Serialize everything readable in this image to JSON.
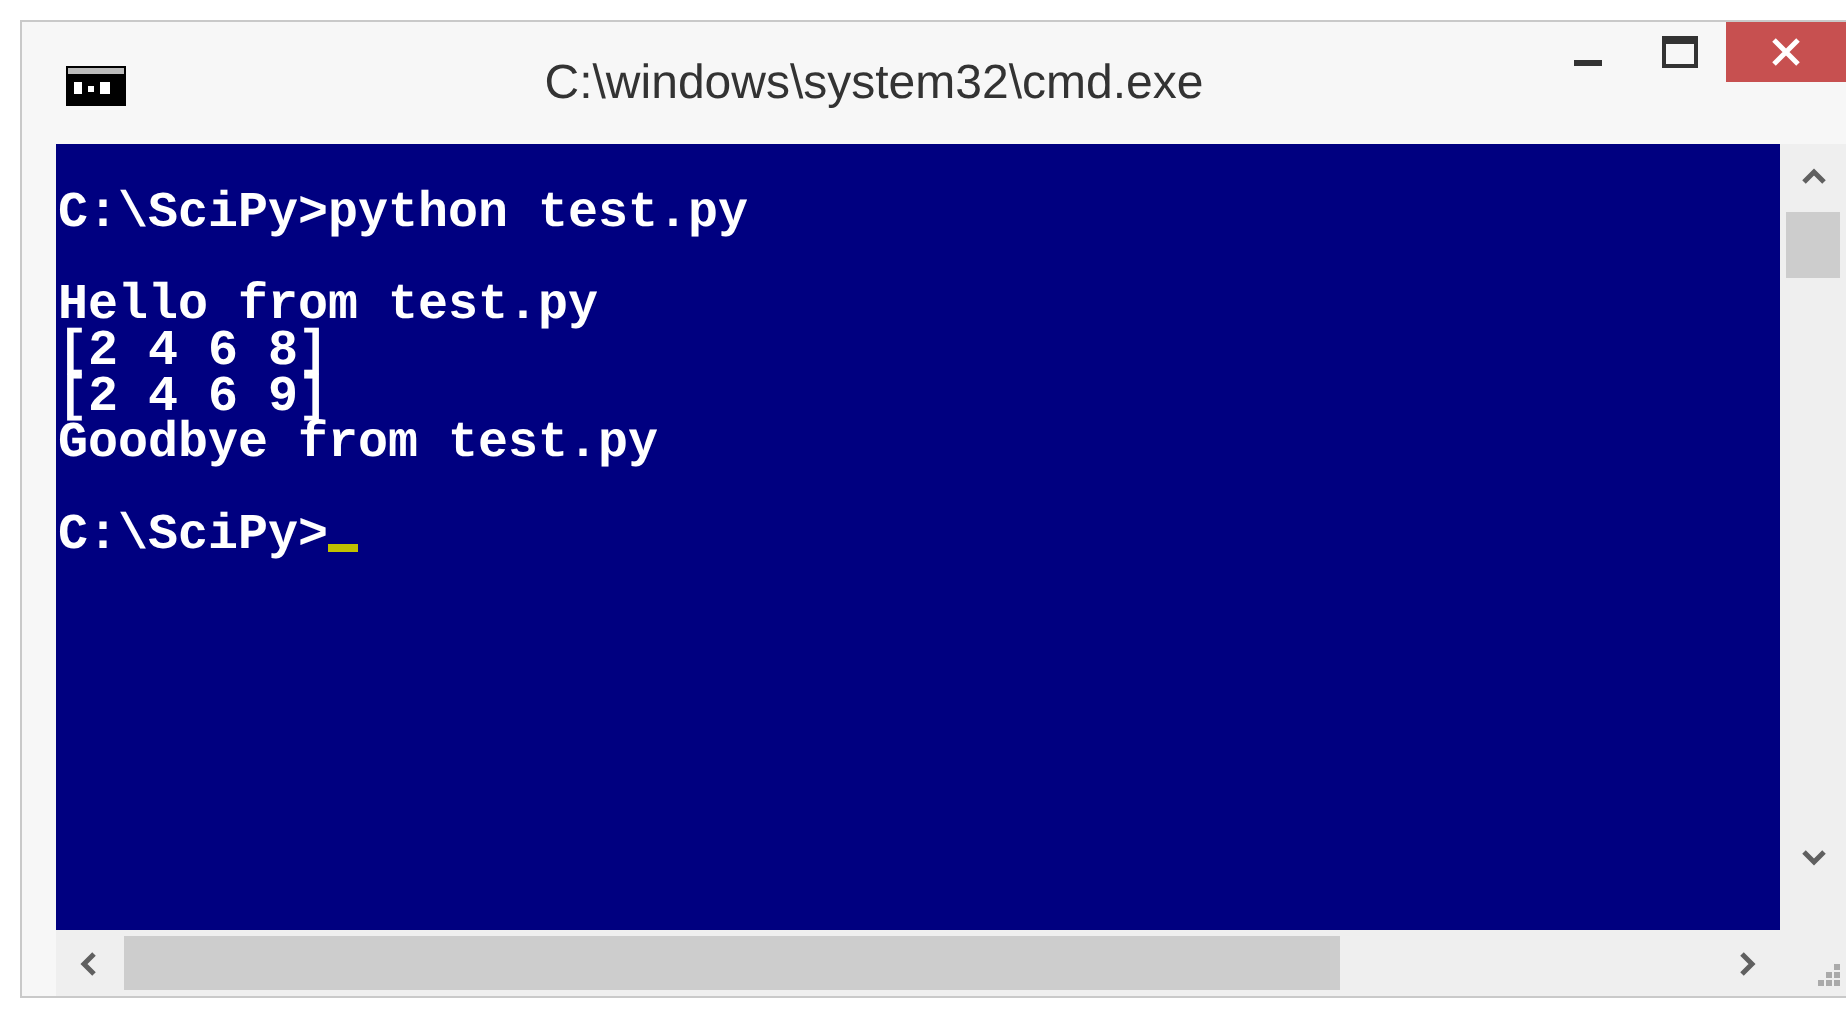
{
  "window": {
    "title": "C:\\windows\\system32\\cmd.exe"
  },
  "console": {
    "blocks": [
      [
        "C:\\SciPy>python test.py"
      ],
      [
        "Hello from test.py",
        "[2 4 6 8]",
        "[2 4 6 9]",
        "Goodbye from test.py"
      ],
      [
        "C:\\SciPy>"
      ]
    ],
    "cursor": true
  }
}
